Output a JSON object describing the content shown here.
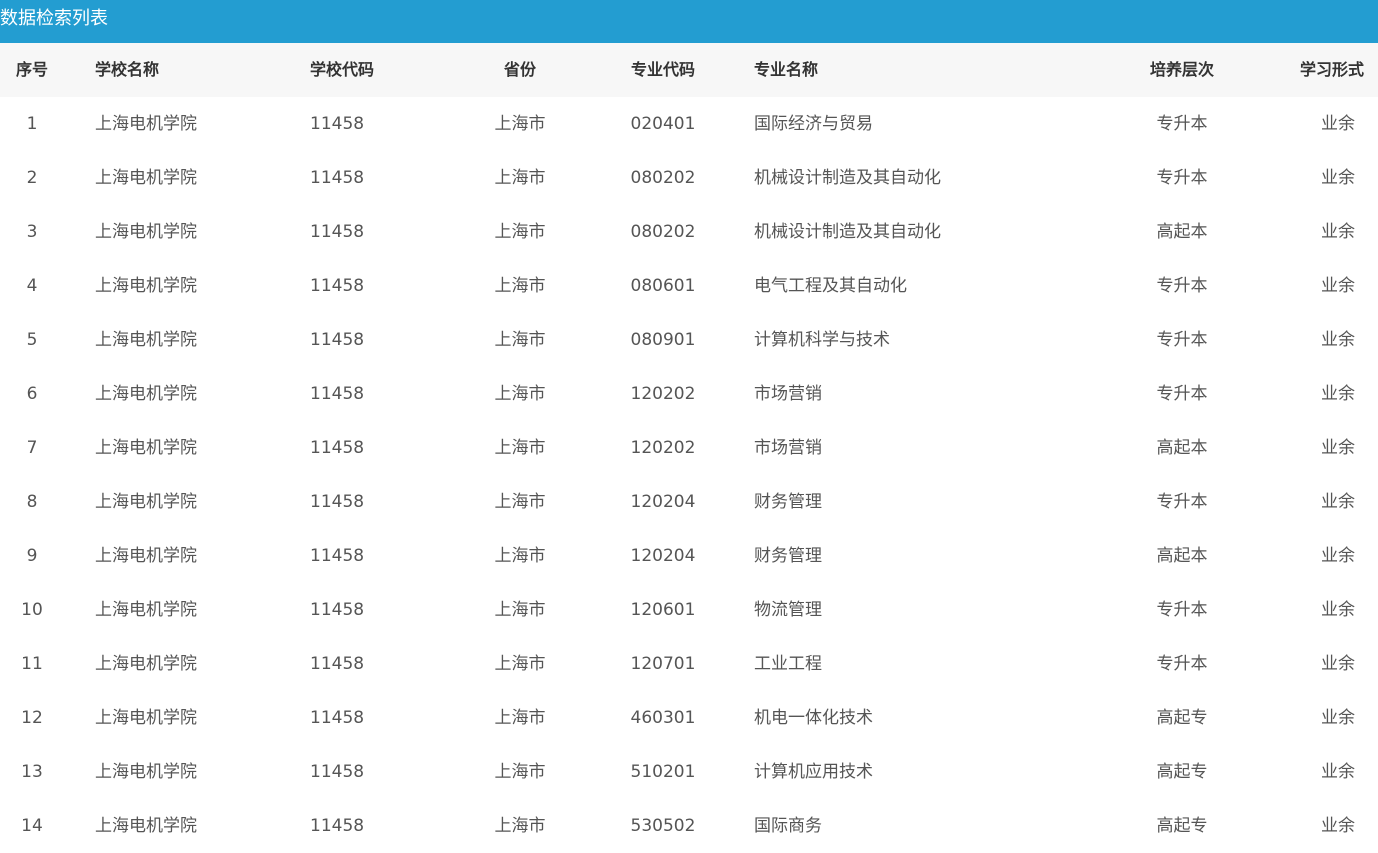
{
  "title": "数据检索列表",
  "columns": {
    "index": "序号",
    "school_name": "学校名称",
    "school_code": "学校代码",
    "province": "省份",
    "major_code": "专业代码",
    "major_name": "专业名称",
    "level": "培养层次",
    "study_mode": "学习形式"
  },
  "rows": [
    {
      "index": "1",
      "school_name": "上海电机学院",
      "school_code": "11458",
      "province": "上海市",
      "major_code": "020401",
      "major_name": "国际经济与贸易",
      "level": "专升本",
      "study_mode": "业余"
    },
    {
      "index": "2",
      "school_name": "上海电机学院",
      "school_code": "11458",
      "province": "上海市",
      "major_code": "080202",
      "major_name": "机械设计制造及其自动化",
      "level": "专升本",
      "study_mode": "业余"
    },
    {
      "index": "3",
      "school_name": "上海电机学院",
      "school_code": "11458",
      "province": "上海市",
      "major_code": "080202",
      "major_name": "机械设计制造及其自动化",
      "level": "高起本",
      "study_mode": "业余"
    },
    {
      "index": "4",
      "school_name": "上海电机学院",
      "school_code": "11458",
      "province": "上海市",
      "major_code": "080601",
      "major_name": "电气工程及其自动化",
      "level": "专升本",
      "study_mode": "业余"
    },
    {
      "index": "5",
      "school_name": "上海电机学院",
      "school_code": "11458",
      "province": "上海市",
      "major_code": "080901",
      "major_name": "计算机科学与技术",
      "level": "专升本",
      "study_mode": "业余"
    },
    {
      "index": "6",
      "school_name": "上海电机学院",
      "school_code": "11458",
      "province": "上海市",
      "major_code": "120202",
      "major_name": "市场营销",
      "level": "专升本",
      "study_mode": "业余"
    },
    {
      "index": "7",
      "school_name": "上海电机学院",
      "school_code": "11458",
      "province": "上海市",
      "major_code": "120202",
      "major_name": "市场营销",
      "level": "高起本",
      "study_mode": "业余"
    },
    {
      "index": "8",
      "school_name": "上海电机学院",
      "school_code": "11458",
      "province": "上海市",
      "major_code": "120204",
      "major_name": "财务管理",
      "level": "专升本",
      "study_mode": "业余"
    },
    {
      "index": "9",
      "school_name": "上海电机学院",
      "school_code": "11458",
      "province": "上海市",
      "major_code": "120204",
      "major_name": "财务管理",
      "level": "高起本",
      "study_mode": "业余"
    },
    {
      "index": "10",
      "school_name": "上海电机学院",
      "school_code": "11458",
      "province": "上海市",
      "major_code": "120601",
      "major_name": "物流管理",
      "level": "专升本",
      "study_mode": "业余"
    },
    {
      "index": "11",
      "school_name": "上海电机学院",
      "school_code": "11458",
      "province": "上海市",
      "major_code": "120701",
      "major_name": "工业工程",
      "level": "专升本",
      "study_mode": "业余"
    },
    {
      "index": "12",
      "school_name": "上海电机学院",
      "school_code": "11458",
      "province": "上海市",
      "major_code": "460301",
      "major_name": "机电一体化技术",
      "level": "高起专",
      "study_mode": "业余"
    },
    {
      "index": "13",
      "school_name": "上海电机学院",
      "school_code": "11458",
      "province": "上海市",
      "major_code": "510201",
      "major_name": "计算机应用技术",
      "level": "高起专",
      "study_mode": "业余"
    },
    {
      "index": "14",
      "school_name": "上海电机学院",
      "school_code": "11458",
      "province": "上海市",
      "major_code": "530502",
      "major_name": "国际商务",
      "level": "高起专",
      "study_mode": "业余"
    }
  ]
}
